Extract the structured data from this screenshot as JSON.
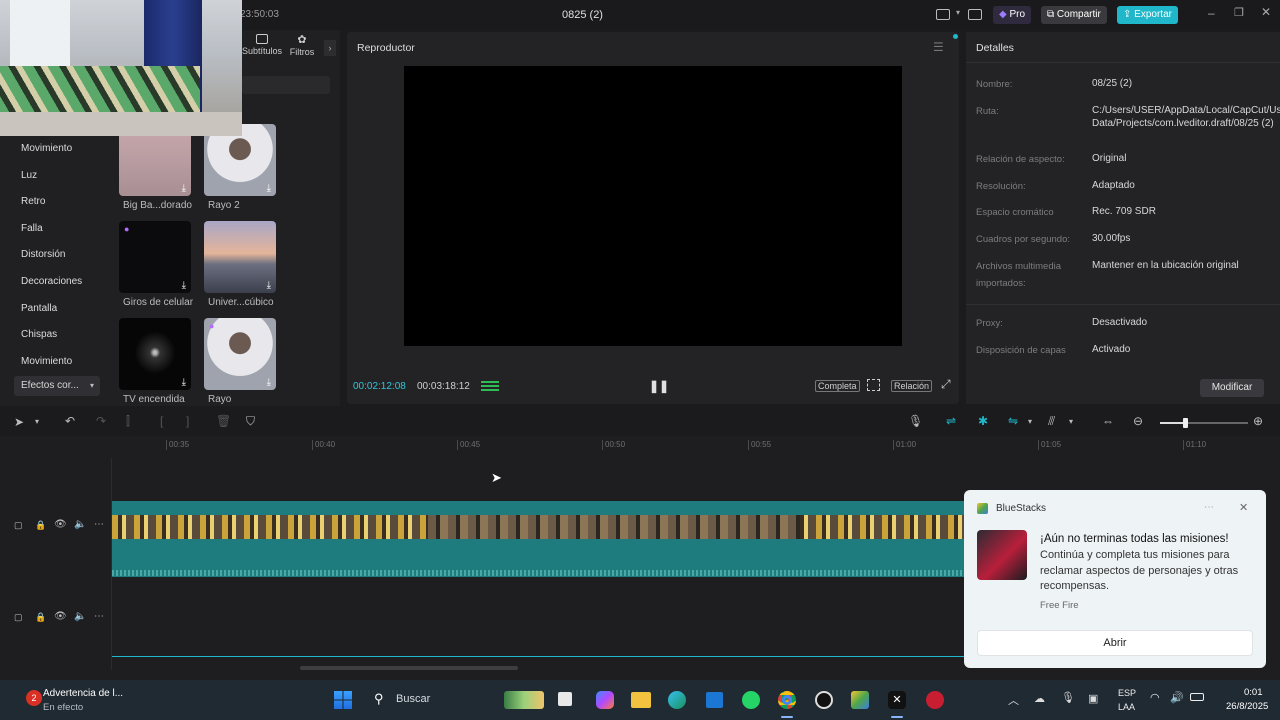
{
  "titlebar": {
    "clock": "23:50:03",
    "project_title": "0825 (2)",
    "pro_label": "Pro",
    "share_label": "Compartir",
    "export_label": "Exportar"
  },
  "left_panel": {
    "tabs": [
      {
        "label": "Subtítulos",
        "icon": "captions-icon"
      },
      {
        "label": "Filtros",
        "icon": "filters-icon"
      }
    ],
    "categories": [
      "Movimiento",
      "Luz",
      "Retro",
      "Falla",
      "Distorsión",
      "Decoraciones",
      "Pantalla",
      "Chispas",
      "Movimiento"
    ],
    "dropdown_label": "Efectos cor...",
    "effects": [
      {
        "label": "Big Ba...dorado",
        "style": "pink"
      },
      {
        "label": "Rayo 2",
        "style": "portrait"
      },
      {
        "label": "Giros de celular",
        "style": "dark"
      },
      {
        "label": "Univer...cúbico",
        "style": "city"
      },
      {
        "label": "TV encendida",
        "style": "tv"
      },
      {
        "label": "Rayo",
        "style": "portrait"
      }
    ]
  },
  "player": {
    "header": "Reproductor",
    "current_time": "00:02:12:08",
    "total_time": "00:03:18:12",
    "full_label": "Completa",
    "ratio_label": "Relación"
  },
  "details": {
    "header": "Detalles",
    "rows": [
      {
        "label": "Nombre:",
        "value": "08/25 (2)"
      },
      {
        "label": "Ruta:",
        "value": "C:/Users/USER/AppData/Local/CapCut/User Data/Projects/com.lveditor.draft/08/25 (2)"
      },
      {
        "label": "Relación de aspecto:",
        "value": "Original"
      },
      {
        "label": "Resolución:",
        "value": "Adaptado"
      },
      {
        "label": "Espacio cromático",
        "value": "Rec. 709 SDR"
      },
      {
        "label": "Cuadros por segundo:",
        "value": "30.00fps"
      },
      {
        "label": "Archivos multimedia importados:",
        "value": "Mantener en la ubicación original"
      },
      {
        "label": "Proxy:",
        "value": "Desactivado"
      },
      {
        "label": "Disposición de capas",
        "value": "Activado"
      }
    ],
    "modify_label": "Modificar"
  },
  "timeline": {
    "ticks": [
      "00:35",
      "00:40",
      "00:45",
      "00:50",
      "00:55",
      "01:00",
      "01:05",
      "01:10"
    ]
  },
  "toast": {
    "app_name": "BlueStacks",
    "heading": "¡Aún no terminas todas las misiones!",
    "body": "Continúa y completa tus misiones para reclamar aspectos de personajes y otras recompensas.",
    "source": "Free Fire",
    "button_label": "Abrir"
  },
  "taskbar": {
    "alert_title": "Advertencia de l...",
    "alert_sub": "En efecto",
    "alert_badge": "2",
    "search_placeholder": "Buscar",
    "lang_top": "ESP",
    "lang_bottom": "LAA",
    "time": "0:01",
    "date": "26/8/2025"
  },
  "colors": {
    "accent": "#1fb7c9",
    "pro": "#7b4dff",
    "track": "#1e7b7e",
    "playhead_time": "#2fc6d6"
  }
}
